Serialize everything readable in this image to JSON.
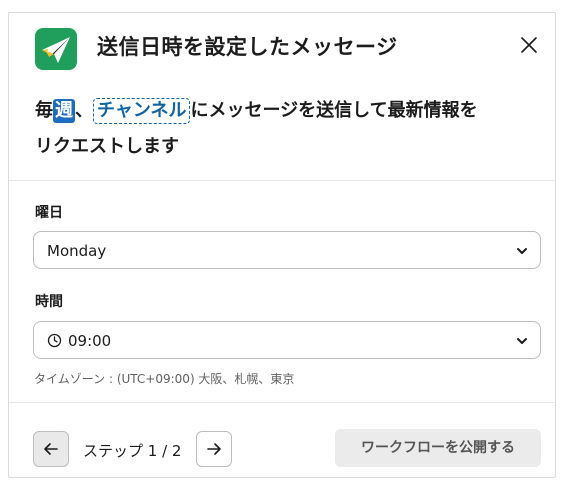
{
  "modal": {
    "title": "送信日時を設定したメッセージ",
    "close_icon": "close-icon"
  },
  "description": {
    "prefix": "毎",
    "variable": "週",
    "separator": "、",
    "channel": "チャンネル",
    "rest_line1": "にメッセージを送信して最新情報を",
    "rest_line2": "リクエストします"
  },
  "fields": {
    "day": {
      "label": "曜日",
      "value": "Monday"
    },
    "time": {
      "label": "時間",
      "value": "09:00",
      "timezone_hint": "タイムゾーン : (UTC+09:00) 大阪、札幌、東京"
    }
  },
  "footer": {
    "step_text": "ステップ 1 / 2",
    "publish_label": "ワークフローを公開する"
  },
  "colors": {
    "app_icon_bg": "#1f9f5b",
    "variable_chip": "#1d6ec1",
    "channel_link": "#1264a3",
    "publish_button_bg": "#ebebeb"
  }
}
